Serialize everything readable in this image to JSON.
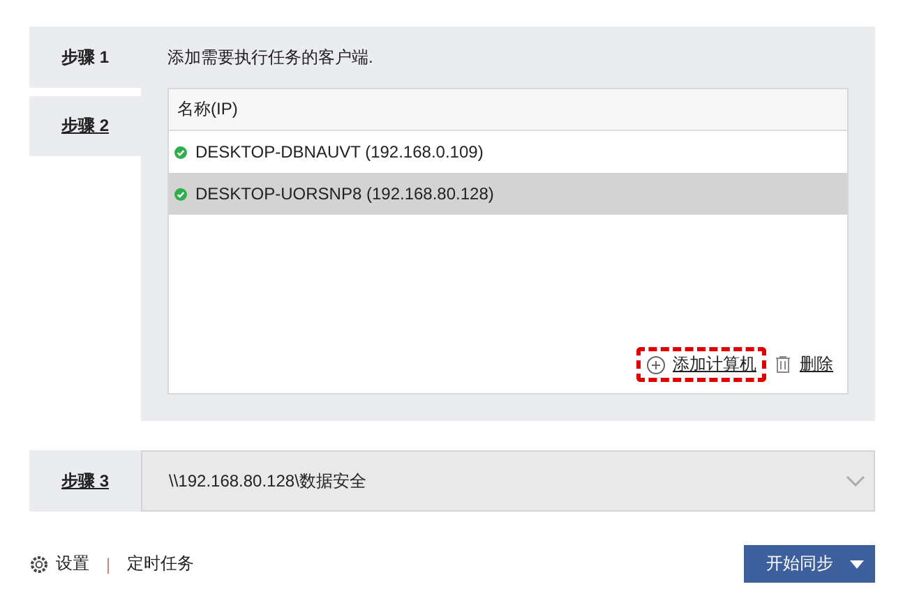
{
  "steps": [
    {
      "label": "步骤 1",
      "selected": true
    },
    {
      "label": "步骤 2",
      "selected": false
    },
    {
      "label": "步骤 3",
      "selected": false
    }
  ],
  "step1_description": "添加需要执行任务的客户端.",
  "client_table": {
    "column": "名称(IP)",
    "rows": [
      {
        "name": "DESKTOP-DBNAUVT (192.168.0.109)",
        "online": true,
        "selected": false
      },
      {
        "name": "DESKTOP-UORSNP8 (192.168.80.128)",
        "online": true,
        "selected": true
      }
    ]
  },
  "add_button": {
    "label": "添加计算机",
    "highlighted": true
  },
  "delete_button": {
    "label": "删除"
  },
  "destination": {
    "value": "\\\\192.168.80.128\\数据安全"
  },
  "footer": {
    "settings": "设置",
    "separator": "|",
    "schedule": "定时任务",
    "start_button": "开始同步"
  }
}
